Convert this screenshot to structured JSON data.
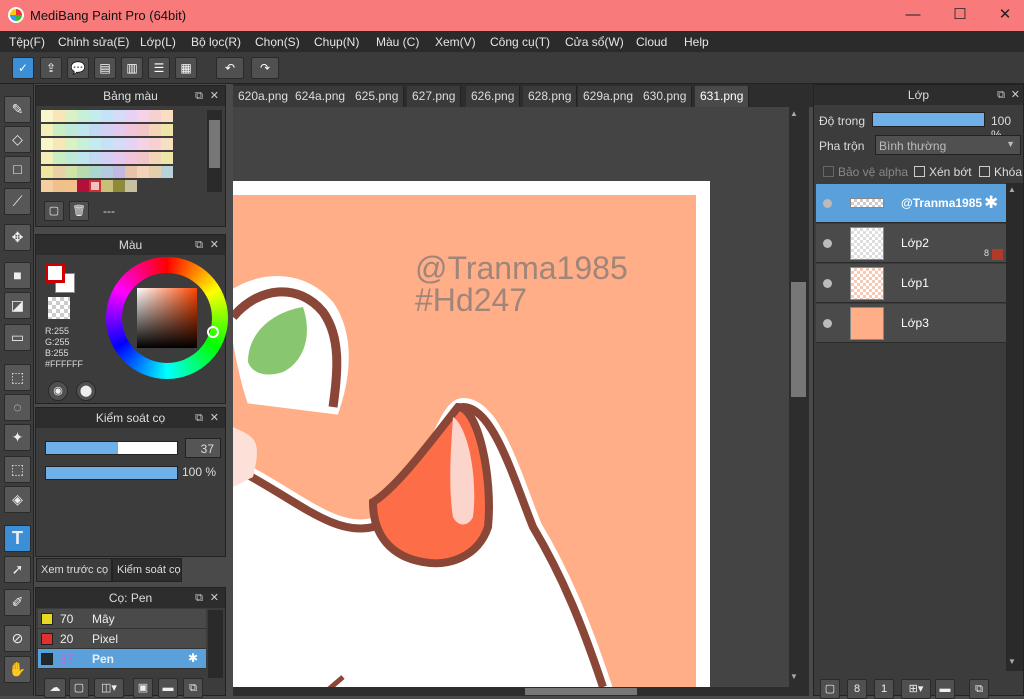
{
  "app": {
    "title": "MediBang Paint Pro (64bit)"
  },
  "window_controls": {
    "minimize": "—",
    "maximize": "☐",
    "close": "✕"
  },
  "menu": [
    "Tệp(F)",
    "Chỉnh sửa(E)",
    "Lớp(L)",
    "Bộ lọc(R)",
    "Chọn(S)",
    "Chụp(N)",
    "Màu (C)",
    "Xem(V)",
    "Công cụ(T)",
    "Cửa sổ(W)",
    "Cloud",
    "Help"
  ],
  "palette_panel": {
    "title": "Bảng màu",
    "footer_text": "---"
  },
  "color_panel": {
    "title": "Màu",
    "r": "R:255",
    "g": "G:255",
    "b": "B:255",
    "hex": "#FFFFFF"
  },
  "brush_control": {
    "title": "Kiểm soát cọ",
    "size_value": "37",
    "opacity_value": "100 %",
    "size_fraction": 0.55,
    "opacity_fraction": 1.0
  },
  "preview_tabs": {
    "tab1": "Xem trước cọ",
    "tab2": "Kiểm soát cọ"
  },
  "brush_panel": {
    "title": "Cọ: Pen",
    "items": [
      {
        "size": "70",
        "name": "Mây",
        "color": "#e8d820"
      },
      {
        "size": "20",
        "name": "Pixel",
        "color": "#e03030"
      },
      {
        "size": "37",
        "name": "Pen",
        "color": "#202830"
      }
    ]
  },
  "tabs": [
    "620a.png",
    "624a.png",
    "625.png",
    "627.png",
    "626.png",
    "628.png",
    "629a.png",
    "630.png",
    "631.png"
  ],
  "active_tab": "631.png",
  "canvas": {
    "watermark_line1": "@Tranma1985",
    "watermark_line2": "#Hd247",
    "bg_color": "#ffae88"
  },
  "layer_panel": {
    "title": "Lớp",
    "opacity_label": "Độ trong",
    "opacity_value": "100 %",
    "blend_label": "Pha trộn",
    "blend_value": "Bình thường",
    "alpha_protect": "Bảo vệ alpha",
    "clipping": "Xén bớt",
    "lock": "Khóa",
    "layers": [
      {
        "name": "@Tranma1985",
        "selected": true
      },
      {
        "name": "Lớp2",
        "badge": "8",
        "selected": false
      },
      {
        "name": "Lớp1",
        "selected": false
      },
      {
        "name": "Lớp3",
        "selected": false
      }
    ]
  }
}
